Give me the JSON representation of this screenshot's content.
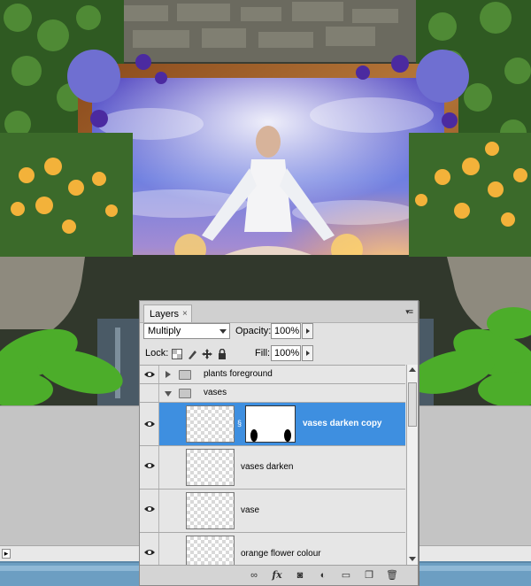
{
  "panel": {
    "tab_label": "Layers",
    "tab_close": "×",
    "menu_icon": "panel-menu-icon",
    "blend_mode": "Multiply",
    "opacity_label": "Opacity:",
    "opacity_value": "100%",
    "lock_label": "Lock:",
    "fill_label": "Fill:",
    "fill_value": "100%"
  },
  "layers": [
    {
      "name": "plants foreground",
      "type": "group",
      "expanded": false,
      "visible": true
    },
    {
      "name": "vases",
      "type": "group",
      "expanded": true,
      "visible": false
    },
    {
      "name": "vases darken copy",
      "type": "layer",
      "has_mask": true,
      "selected": true,
      "visible": true
    },
    {
      "name": "vases darken",
      "type": "layer",
      "selected": false,
      "visible": true
    },
    {
      "name": "vase",
      "type": "layer",
      "selected": false,
      "visible": true
    },
    {
      "name": "orange flower colour",
      "type": "layer",
      "selected": false,
      "visible": true
    }
  ],
  "footer_icons": [
    "link-layers-icon",
    "fx-icon",
    "add-mask-icon",
    "adjustment-layer-icon",
    "new-group-icon",
    "new-layer-icon",
    "trash-icon"
  ],
  "footer_glyphs": {
    "fx": "fx"
  },
  "colors": {
    "selection": "#3e8fe0",
    "panel_bg": "#e2e2e2",
    "status_bar": "#6c9ec2"
  }
}
